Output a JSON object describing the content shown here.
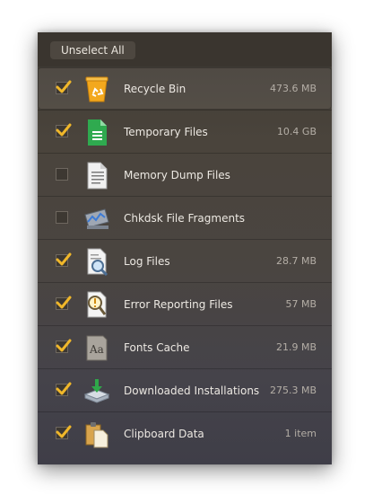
{
  "toolbar": {
    "unselect_label": "Unselect All"
  },
  "items": [
    {
      "label": "Recycle Bin",
      "size": "473.6 MB",
      "checked": true,
      "icon": "recycle-bin-icon"
    },
    {
      "label": "Temporary Files",
      "size": "10.4 GB",
      "checked": true,
      "icon": "temporary-files-icon"
    },
    {
      "label": "Memory Dump Files",
      "size": "",
      "checked": false,
      "icon": "memory-dump-icon"
    },
    {
      "label": "Chkdsk File Fragments",
      "size": "",
      "checked": false,
      "icon": "chkdsk-icon"
    },
    {
      "label": "Log Files",
      "size": "28.7 MB",
      "checked": true,
      "icon": "log-files-icon"
    },
    {
      "label": "Error Reporting Files",
      "size": "57 MB",
      "checked": true,
      "icon": "error-reporting-icon"
    },
    {
      "label": "Fonts Cache",
      "size": "21.9 MB",
      "checked": true,
      "icon": "fonts-cache-icon"
    },
    {
      "label": "Downloaded Installations",
      "size": "275.3 MB",
      "checked": true,
      "icon": "downloaded-installations-icon"
    },
    {
      "label": "Clipboard Data",
      "size": "1 item",
      "checked": true,
      "icon": "clipboard-icon"
    }
  ],
  "colors": {
    "check": "#f0b72a",
    "panel": "#48423b",
    "text": "#ece8e2",
    "muted": "#b4aea6"
  }
}
